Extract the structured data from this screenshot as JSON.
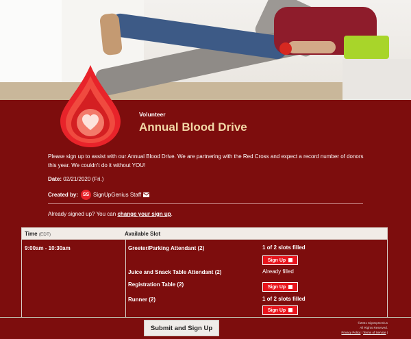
{
  "event": {
    "subtitle": "Volunteer",
    "title": "Annual Blood Drive",
    "description": "Please sign up to assist with our Annual Blood Drive.  We are partnering with the Red Cross and expect a record number of donors this year.  We couldn't do it without YOU!",
    "date_label": "Date:",
    "date_value": "02/21/2020 (Fri.)",
    "created_by_label": "Created by:",
    "creator_initials": "SS",
    "creator_name": "SignUpGenius Staff"
  },
  "already": {
    "prefix": "Already signed up? You can",
    "link": "change your sign up",
    "suffix": "."
  },
  "table": {
    "time_header": "Time",
    "time_zone": "(EDT)",
    "slot_header": "Available Slot",
    "time": "9:00am - 10:30am",
    "slots": [
      {
        "name": "Greeter/Parking Attendant (2)",
        "status": "1 of 2 slots filled",
        "button": "Sign Up"
      },
      {
        "name": "Juice and Snack Table Attendant (2)",
        "status": "Already filled",
        "button": ""
      },
      {
        "name": "Registration Table (2)",
        "status": "",
        "button": "Sign Up"
      },
      {
        "name": "Runner (2)",
        "status": "1 of 2 slots filled",
        "button": "Sign Up"
      }
    ]
  },
  "footer": {
    "submit": "Submit and Sign Up",
    "copyright": "©2021 SignUpGenius",
    "rights": "All Rights Reserved.",
    "privacy": "Privacy Policy",
    "sep": "|",
    "terms": "Terms of Service",
    "sep2": "|"
  },
  "colors": {
    "panel": "#7d0d0d",
    "title": "#f2d7a6",
    "button": "#e8141c"
  },
  "icons": {
    "drop": "blood-drop-heart-icon",
    "mail": "mail-icon",
    "checkbox": "checkbox-icon"
  }
}
